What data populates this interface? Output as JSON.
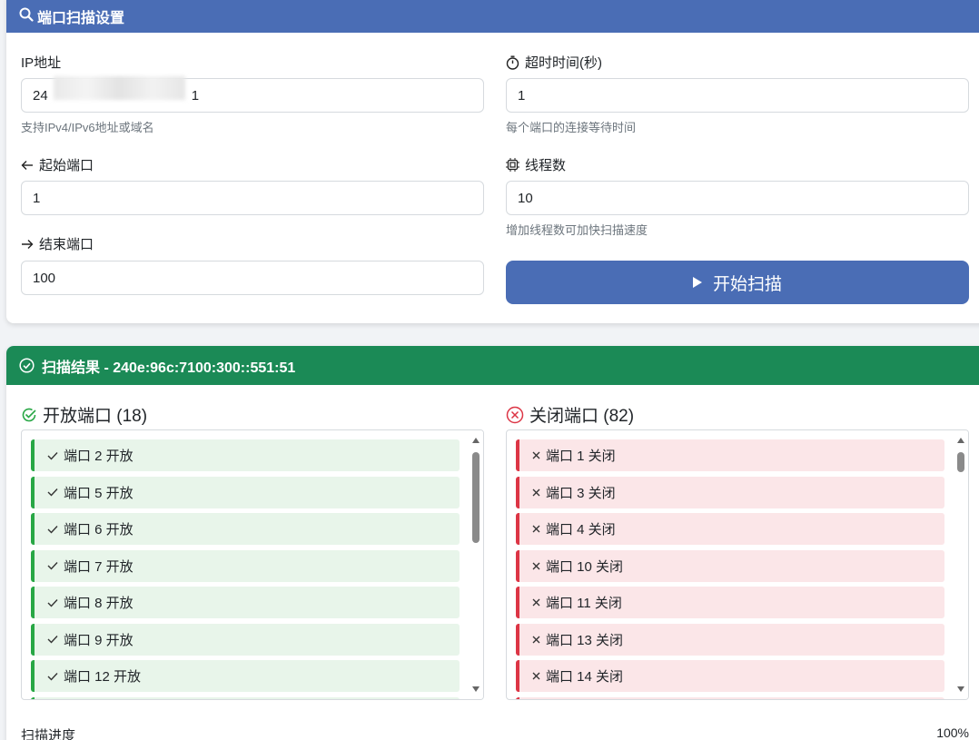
{
  "settings": {
    "title": "端口扫描设置",
    "ip": {
      "label": "IP地址",
      "value_prefix": "24",
      "value_suffix": "1",
      "hint": "支持IPv4/IPv6地址或域名"
    },
    "timeout": {
      "label": "超时时间(秒)",
      "value": "1",
      "hint": "每个端口的连接等待时间",
      "icon": "stopwatch-icon"
    },
    "start_port": {
      "label": "起始端口",
      "value": "1",
      "icon": "arrow-left-icon"
    },
    "threads": {
      "label": "线程数",
      "value": "10",
      "hint": "增加线程数可加快扫描速度",
      "icon": "cpu-icon"
    },
    "end_port": {
      "label": "结束端口",
      "value": "100",
      "icon": "arrow-right-icon"
    },
    "start_button": "开始扫描"
  },
  "results": {
    "title": "扫描结果 - 240e:96c:7100:300::551:51",
    "open": {
      "title": "开放端口 (18)",
      "items": [
        "端口 2 开放",
        "端口 5 开放",
        "端口 6 开放",
        "端口 7 开放",
        "端口 8 开放",
        "端口 9 开放",
        "端口 12 开放"
      ]
    },
    "closed": {
      "title": "关闭端口 (82)",
      "items": [
        "端口 1 关闭",
        "端口 3 关闭",
        "端口 4 关闭",
        "端口 10 关闭",
        "端口 11 关闭",
        "端口 13 关闭",
        "端口 14 关闭"
      ]
    },
    "progress_label": "扫描进度",
    "progress_value": "100%"
  },
  "colors": {
    "header_blue": "#4a6db5",
    "header_green": "#1b8a56",
    "open_accent": "#28a745",
    "closed_accent": "#dc3545"
  }
}
